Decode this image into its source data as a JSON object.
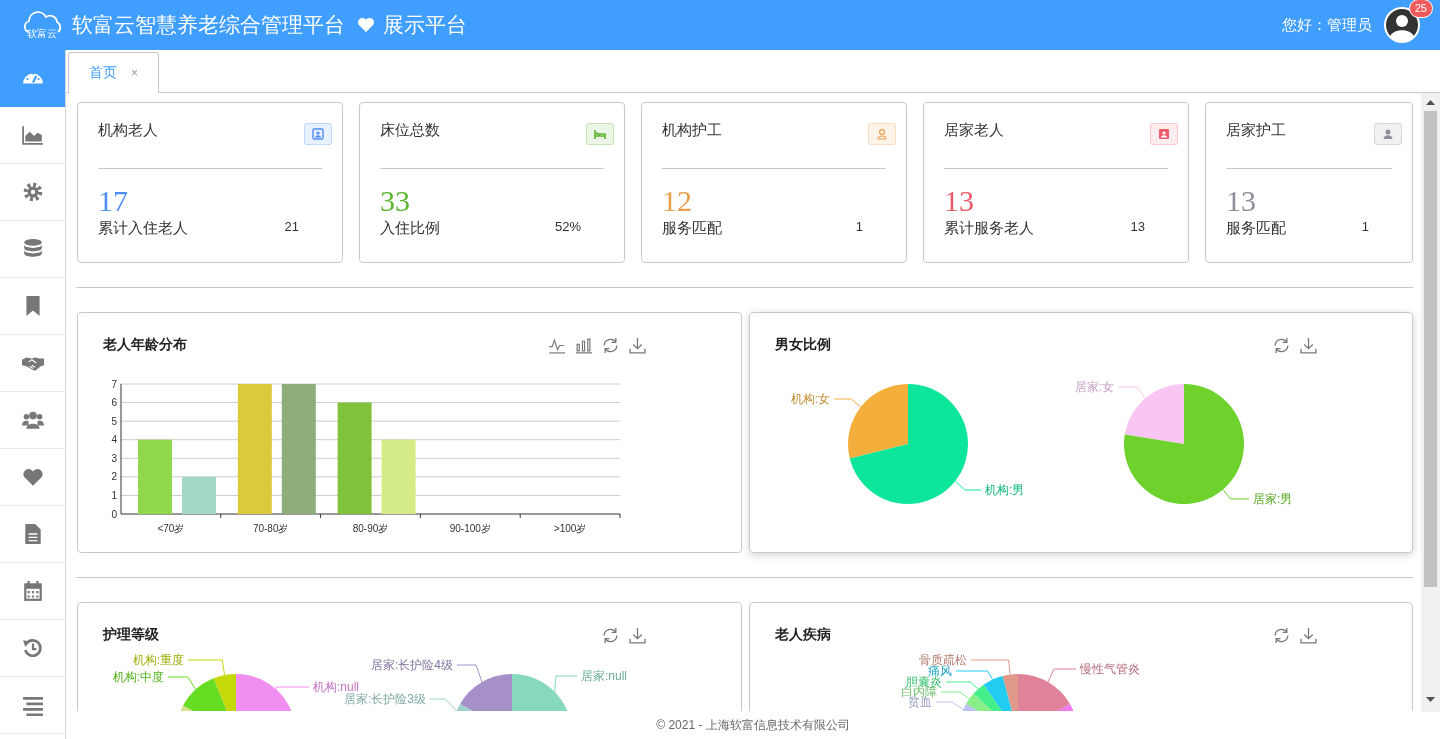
{
  "header": {
    "logo_text": "软富云",
    "title": "软富云智慧养老综合管理平台",
    "subtitle": "展示平台",
    "greeting": "您好：管理员",
    "notification_count": "25"
  },
  "sidebar": {
    "items": [
      {
        "selected": true
      },
      {
        "selected": false
      },
      {
        "selected": false
      },
      {
        "selected": false
      },
      {
        "selected": false
      },
      {
        "selected": false
      },
      {
        "selected": false
      },
      {
        "selected": false
      },
      {
        "selected": false
      },
      {
        "selected": false
      },
      {
        "selected": false
      },
      {
        "selected": false
      }
    ]
  },
  "tabs": [
    {
      "label": "首页",
      "close": "×",
      "selected": true
    }
  ],
  "stat_cards": [
    {
      "title": "机构老人",
      "value": "17",
      "color": "#4d8ef7",
      "sub_label": "累计入住老人",
      "sub_value": "21"
    },
    {
      "title": "床位总数",
      "value": "33",
      "color": "#5cb531",
      "sub_label": "入住比例",
      "sub_value": "52%"
    },
    {
      "title": "机构护工",
      "value": "12",
      "color": "#e8a04a",
      "sub_label": "服务匹配",
      "sub_value": "1"
    },
    {
      "title": "居家老人",
      "value": "13",
      "color": "#ee5b6a",
      "sub_label": "累计服务老人",
      "sub_value": "13"
    },
    {
      "title": "居家护工",
      "value": "13",
      "color": "#8a8f99",
      "sub_label": "服务匹配",
      "sub_value": "1"
    }
  ],
  "age_chart": {
    "title": "老人年龄分布",
    "chart_data": {
      "type": "bar",
      "categories": [
        "<70岁",
        "70-80岁",
        "80-90岁",
        "90-100岁",
        ">100岁"
      ],
      "series": [
        {
          "values": [
            4,
            7,
            6,
            0,
            0
          ],
          "colors": [
            "#92d84c",
            "#dcca3d",
            "#80c23c",
            null,
            null
          ]
        },
        {
          "values": [
            2,
            7,
            4,
            0,
            0
          ],
          "colors": [
            "#a3d8c5",
            "#8dad7b",
            "#d3ec87",
            null,
            null
          ]
        }
      ],
      "ylim": [
        0,
        7
      ],
      "yticks": [
        0,
        1,
        2,
        3,
        4,
        5,
        6,
        7
      ],
      "grid": true
    }
  },
  "gender_chart": {
    "title": "男女比例",
    "pies": [
      {
        "slices": [
          {
            "label": "机构:女",
            "color": "#f4ae3c"
          },
          {
            "label": "机构:男",
            "color": "#0ce69a"
          }
        ]
      },
      {
        "slices": [
          {
            "label": "居家:女",
            "color": "#f9c6f3"
          },
          {
            "label": "居家:男",
            "color": "#6ed12c"
          }
        ]
      }
    ]
  },
  "care_level_chart": {
    "title": "护理等级",
    "pies": [
      {
        "slices": [
          {
            "label": "机构:重度",
            "color": "#c5d90a"
          },
          {
            "label": "机构:中度",
            "color": "#66dd22"
          },
          {
            "label": "机构:null",
            "color": "#f08ff0"
          },
          {
            "color": "#d9e08f"
          }
        ]
      },
      {
        "slices": [
          {
            "label": "居家:长护险4级",
            "color": "#a590c8"
          },
          {
            "label": "居家:null",
            "color": "#86d9bd"
          },
          {
            "label": "居家:长护险3级",
            "color": "#9fd2cb"
          }
        ]
      }
    ]
  },
  "disease_chart": {
    "title": "老人疾病",
    "pies": [
      {
        "slices": [
          {
            "label": "骨质疏松",
            "color": "#e09888"
          },
          {
            "label": "慢性气管炎",
            "color": "#e08299"
          },
          {
            "label": "痛风",
            "color": "#22ccf0"
          },
          {
            "label": "胆囊炎",
            "color": "#44ee88"
          },
          {
            "label": "白内障",
            "color": "#88ee88"
          },
          {
            "label": "贫血",
            "color": "#b9c2f0"
          },
          {
            "color": "#f07bef"
          }
        ]
      }
    ]
  },
  "footer": {
    "copyright": "© 2021 - 上海软富信息技术有限公司"
  }
}
